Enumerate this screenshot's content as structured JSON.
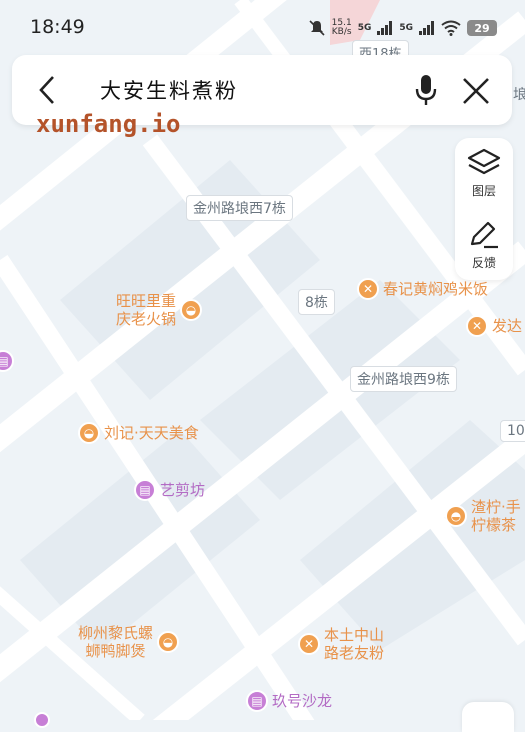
{
  "status_bar": {
    "time": "18:49",
    "net_speed_top": "15.1",
    "net_speed_bottom": "KB/s",
    "signal_a": "5G",
    "signal_b": "5G",
    "battery": "29"
  },
  "search": {
    "query": "大安生料煮粉"
  },
  "watermark": "xunfang.io",
  "tools": {
    "layers_label": "图层",
    "feedback_label": "反馈"
  },
  "road_labels": [
    {
      "text": "金州路埌西7栋"
    },
    {
      "text": "8栋"
    },
    {
      "text": "金州路埌西9栋"
    },
    {
      "text": "10"
    }
  ],
  "top_label": "西18栋",
  "right_edge_label": "埌",
  "pois": [
    {
      "line1": "旺旺里重",
      "line2": "庆老火锅",
      "kind": "restaurant"
    },
    {
      "line1": "春记黄焖鸡米饭",
      "line2": "",
      "kind": "fastfood"
    },
    {
      "line1": "发达",
      "line2": "",
      "kind": "fastfood"
    },
    {
      "line1": "刘记·天天美食",
      "line2": "",
      "kind": "restaurant"
    },
    {
      "line1": "艺剪坊",
      "line2": "",
      "kind": "shop"
    },
    {
      "line1": "渣柠·手",
      "line2": "柠檬茶",
      "kind": "drink"
    },
    {
      "line1": "柳州黎氏螺",
      "line2": "蛳鸭脚煲",
      "kind": "restaurant"
    },
    {
      "line1": "本土中山",
      "line2": "路老友粉",
      "kind": "fastfood"
    },
    {
      "line1": "玖号沙龙",
      "line2": "",
      "kind": "shop"
    }
  ],
  "colors": {
    "map_bg": "#eef3f7",
    "road": "#ffffff",
    "poi_orange": "#f0a050",
    "poi_purple": "#c77fd6",
    "block": "#e3eaf0"
  }
}
